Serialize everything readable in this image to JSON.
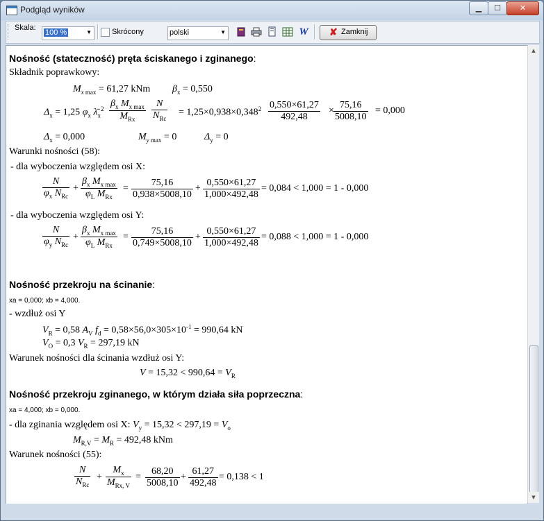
{
  "window": {
    "title": "Podgląd wyników",
    "min": "▁",
    "max": "☐",
    "close": "✕"
  },
  "toolbar": {
    "scale_label": "Skala:",
    "scale_value": "100 %",
    "short_label": "Skrócony",
    "language_value": "polski",
    "close_label": "Zamknij"
  },
  "doc": {
    "h1": "Nośność (stateczność) pręta ściskanego i zginanego",
    "colon": ":",
    "t_skladnik": "Składnik poprawkowy:",
    "mx_max": "= 61,27 kNm",
    "beta_x": "= 0,550",
    "delta_eq_prefix": "= 1,25",
    "delta_eq_vals": "= 1,25×0,938×0,348",
    "f1_num": "0,550×61,27",
    "f1_den": "492,48",
    "f2_num": "75,16",
    "f2_den": "5008,10",
    "res1": "= 0,000",
    "delta_x_zero": "= 0,000",
    "my_max": "= 0",
    "delta_y_zero": "= 0",
    "warunki_nosnosci": "Warunki nośności (58):",
    "dla_x": "- dla wyboczenia względem osi X:",
    "x_a_num": "75,16",
    "x_a_den": "0,938×5008,10",
    "x_b_num": "0,550×61,27",
    "x_b_den": "1,000×492,48",
    "x_result": "= 0,084 < 1,000 = 1 - 0,000",
    "dla_y": "- dla wyboczenia względem osi Y:",
    "y_a_num": "75,16",
    "y_a_den": "0,749×5008,10",
    "y_b_num": "0,550×61,27",
    "y_b_den": "1,000×492,48",
    "y_result": "= 0,088 < 1,000 = 1 - 0,000",
    "h2": "Nośność przekroju na ścinanie",
    "xa_xb_1": "xa = 0,000;  xb = 4,000.",
    "wzdluz_y": "- wzdłuż osi Y",
    "vr_eq": "= 0,58×56,0×305×10",
    "vr_exp": "-1",
    "vr_res": "= 990,64 kN",
    "vo_eq": "= 297,19 kN",
    "warunek_scinania": "Warunek nośności dla ścinania wzdłuż osi Y:",
    "v_cond": "= 15,32 < 990,64 =",
    "h3": "Nośność przekroju zginanego, w którym działa siła poprzeczna",
    "xa_xb_2": "xa = 4,000;  xb = 0,000.",
    "dla_zginania": "- dla zginania względem osi X:",
    "vy_cond": "= 15,32 < 297,19 =",
    "mrv_eq": "= 492,48 kNm",
    "warunek_55": "Warunek nośności (55):",
    "z_a_num": "68,20",
    "z_a_den": "5008,10",
    "z_b_num": "61,27",
    "z_b_den": "492,48",
    "z_result": "= 0,138 < 1"
  }
}
